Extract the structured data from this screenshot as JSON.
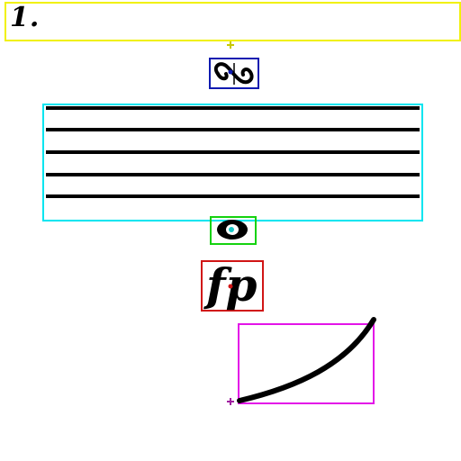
{
  "measure": {
    "number": "1."
  },
  "dynamic": {
    "text": "fp"
  },
  "colors": {
    "measure_box": "#f1f10a",
    "turn_box": "#0e1ab0",
    "staff_box": "#00e5f0",
    "notehead_box": "#15d20f",
    "dynamic_box": "#d11515",
    "slur_box": "#e314e8"
  },
  "symbols": [
    "measure-number",
    "turn-ornament",
    "staff",
    "notehead",
    "dynamic",
    "slur"
  ]
}
